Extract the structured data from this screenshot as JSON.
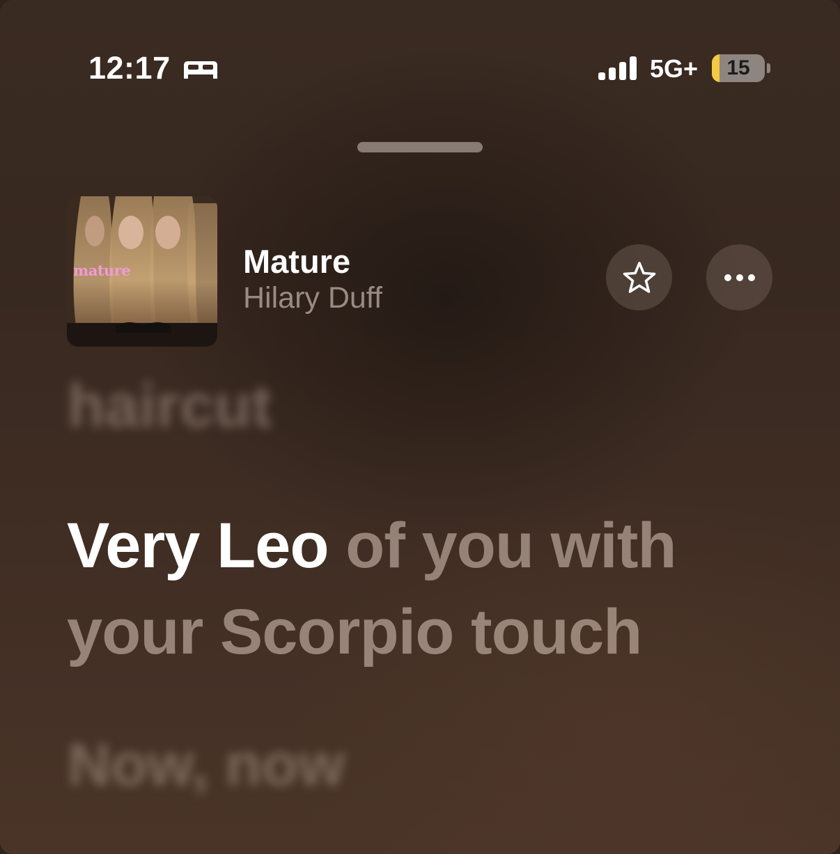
{
  "status_bar": {
    "time": "12:17",
    "focus_icon": "bed-icon",
    "signal_icon": "cellular-signal-icon",
    "network": "5G+",
    "battery_level": "15",
    "battery_fraction": 0.15,
    "battery_color": "#f5c940"
  },
  "now_playing": {
    "artwork_text": "mature",
    "title": "Mature",
    "artist": "Hilary Duff",
    "favorite_icon": "star-outline-icon",
    "more_icon": "ellipsis-icon"
  },
  "lyrics": {
    "previous_line": "haircut",
    "current_sung": "Very Leo",
    "current_rest_1": " of you with",
    "current_rest_2": "your Scorpio touch",
    "next_line": "Now, now"
  },
  "colors": {
    "background": "#3a2b22",
    "accent_text": "#ffffff",
    "artwork_text": "#f29ad8"
  }
}
